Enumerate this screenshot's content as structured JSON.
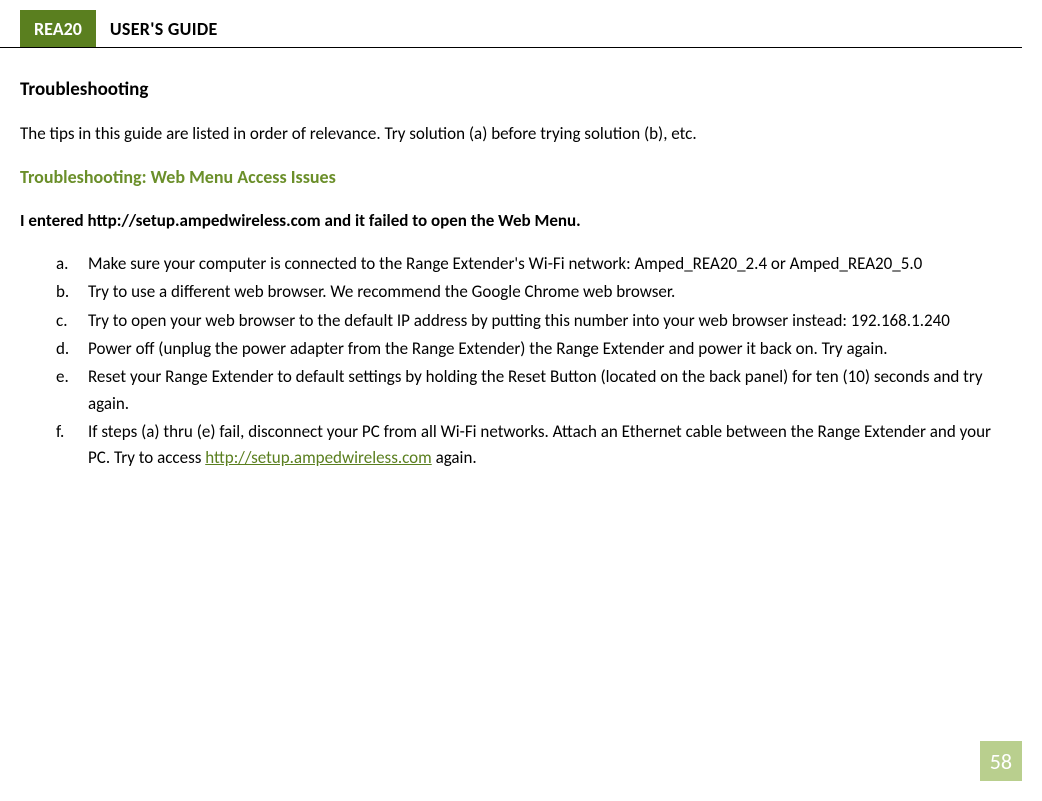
{
  "header": {
    "badge": "REA20",
    "title": "USER'S GUIDE"
  },
  "main": {
    "section_heading": "Troubleshooting",
    "intro": "The tips in this guide are listed in order of relevance. Try solution (a) before trying solution (b), etc.",
    "sub_heading": "Troubleshooting: Web Menu Access Issues",
    "question": "I entered http://setup.ampedwireless.com and it failed to open the Web Menu.",
    "items": {
      "a": {
        "marker": "a.",
        "text": "Make sure your computer is connected to the Range Extender's Wi-Fi network: Amped_REA20_2.4 or Amped_REA20_5.0"
      },
      "b": {
        "marker": "b.",
        "text": "Try to use a different web browser. We recommend the Google Chrome web browser."
      },
      "c": {
        "marker": "c.",
        "text": "Try to open your web browser to the default IP address by putting this number into your web browser instead: 192.168.1.240"
      },
      "d": {
        "marker": "d.",
        "text": "Power off (unplug the power adapter from the Range Extender) the Range Extender and power it back on. Try again."
      },
      "e": {
        "marker": "e.",
        "text": "Reset your Range Extender to default settings by holding the Reset Button (located on the back panel) for ten (10) seconds and try again."
      },
      "f": {
        "marker": "f.",
        "prefix": "If steps (a) thru (e) fail, disconnect your PC from all Wi-Fi networks. Attach an Ethernet cable between the Range Extender and your PC. Try to access ",
        "link": "http://setup.ampedwireless.com",
        "suffix": " again."
      }
    }
  },
  "page_number": "58"
}
